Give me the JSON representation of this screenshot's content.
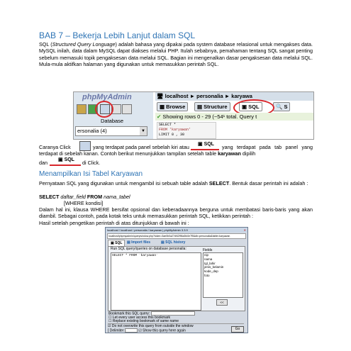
{
  "doc": {
    "title": "BAB 7 – Bekerja Lebih Lanjut dalam SQL",
    "intro_p1_a": "SQL (",
    "intro_p1_italic": "Structured Query Longuage",
    "intro_p1_b": ") adalah bahasa yang dipakai pada system database relasional untuk mengakses data. MySQL inilah, data dalam MySQL dapat diakses melalui PHP. Itulah sebabnya, pemahaman tentang SQL sangat penting sebelum memasuki topik pengaksesan data melalui SQL. Bagian ini mengenalkan dasar pengaksesan data melalui SQL. Mula-mula aktifkan halaman yang digunakan untuk memasukkan perintah SQL.",
    "click_a": "Caranya Click",
    "click_b": "yang terdapat pada panel sebelah kiri atau",
    "click_c": "yang terdapat pada tab panel yang terdapat di sebelah kanan. Contoh berikut menunjukkan tampilan setelah table",
    "click_bold": "karyawan",
    "click_d": "dipilih",
    "click_e": "dan",
    "click_f": "di Click.",
    "section_heading": "Menampilkan Isi Tabel Karyawan",
    "sec_p1_a": "Pernyataan SQL yang digunakan untuk mengambil isi sebuah table adalah",
    "sec_p1_bold": "SELECT",
    "sec_p1_b": ". Bentuk dasar perintah ini adalah :",
    "syntax_select": "SELECT",
    "syntax_field": "daftar_field",
    "syntax_from": "FROM",
    "syntax_table": "nama_tabel",
    "syntax_where": "[WHERE kondisi]",
    "sec_p2": "Dalam hal ini, klausa WHERE bersifat opsional dan keberadaannya berguna untuk membatasi baris-baris yang akan diambil. Sebagai contoh, pada kotak teks untuk memasukkan perintah SQL, ketikkan perintah :",
    "sec_p3": "Hasil setelah pengetikan perintah di atas ditunjukkan di bawah ini :"
  },
  "screenshot_top": {
    "logo": "phpMyAdmin",
    "database_label": "Database",
    "database_value": "ersonalia (4)",
    "breadcrumb": [
      "localhost",
      "personalia",
      "karyawa"
    ],
    "tabs": [
      "Browse",
      "Structure",
      "SQL",
      "S"
    ],
    "status": "Showing rows 0 - 29 (~54¹ total. Query t",
    "sql_lines": [
      "SELECT *",
      "FROM 'karyawan'",
      "LIMIT 0 , 30"
    ]
  },
  "inline_sql_label": "SQL",
  "window": {
    "title": "localhost / localhost / personalia / karyawan | phpMyAdmin 3.3.9",
    "url": "localhost/phpmyadmin/querywindow.php?token=3ae0b0a27df42f96a3fc0e7f5&db=personalia&table=karyawan",
    "tabs": [
      "SQL",
      "Import files",
      "SQL history"
    ],
    "legend": "Run SQL query/queries on database personalia:",
    "query": "SELECT * FROM `karyawan`",
    "fields_label": "Fields",
    "fields": [
      "nip",
      "nama",
      "tgl_lahir",
      "jenis_kelamin",
      "kode_dep",
      "foto"
    ],
    "insert_btn": "<<",
    "bookmark_label": "Bookmark this SQL query:",
    "check1": "Let every user access this bookmark",
    "check2": "Replace existing bookmark of same name",
    "check3": "Do not overwrite this query from outside the window",
    "delimiter_label": "[ Delimiter",
    "delimiter_value": ";",
    "show_again": "Show this query here again",
    "go_btn": "Go"
  },
  "colors": {
    "heading": "#2e74b5",
    "ring": "#d9262b",
    "pma_blue": "#1b5ea8"
  }
}
